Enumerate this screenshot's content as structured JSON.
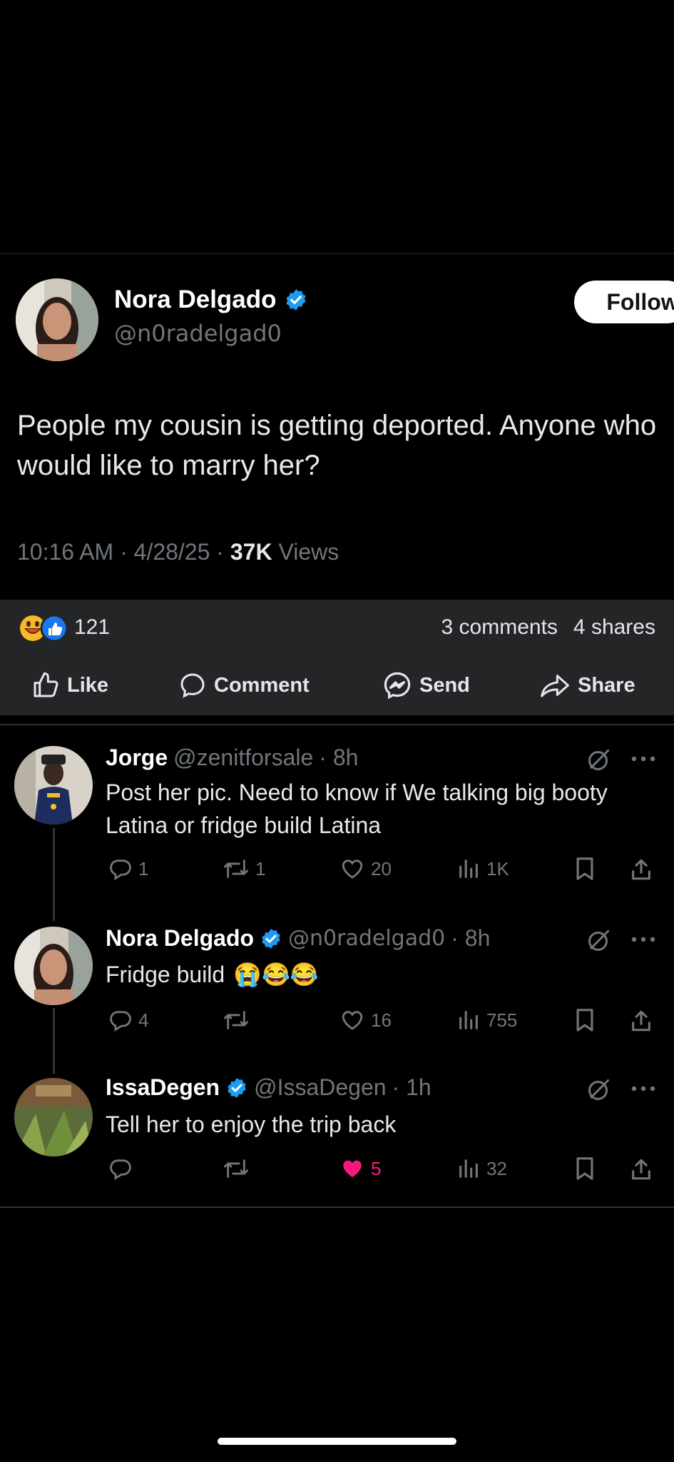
{
  "post": {
    "author_name": "Nora Delgado",
    "handle": "@n0radelgad0",
    "follow_label": "Follow",
    "text": "People my cousin is getting deported. Anyone who would like to marry her?",
    "time": "10:16 AM · 4/28/25 · ",
    "views_count": "37K",
    "views_label": " Views"
  },
  "facebook": {
    "reaction_count": "121",
    "comments": "3 comments",
    "shares": "4 shares",
    "actions": {
      "like": "Like",
      "comment": "Comment",
      "send": "Send",
      "share": "Share"
    }
  },
  "replies": [
    {
      "name": "Jorge",
      "handle": "@zenitforsale",
      "time": "· 8h",
      "text": "Post her pic. Need to know if We talking big booty Latina or fridge build Latina",
      "replies": "1",
      "reposts": "1",
      "likes": "20",
      "views": "1K"
    },
    {
      "name": "Nora Delgado",
      "handle": "@n0radelgad0",
      "time": "· 8h",
      "text": "Fridge build",
      "emojis": "😭😂😂",
      "replies": "4",
      "reposts": "",
      "likes": "16",
      "views": "755"
    },
    {
      "name": "IssaDegen",
      "handle": "@IssaDegen",
      "time": "· 1h",
      "text": "Tell her to enjoy the trip back",
      "replies": "",
      "reposts": "",
      "likes": "5",
      "views": "32"
    }
  ],
  "colors": {
    "verified": "#1d9bf0",
    "liked": "#f91880",
    "fb_bar": "#242526",
    "muted": "#71767b"
  }
}
